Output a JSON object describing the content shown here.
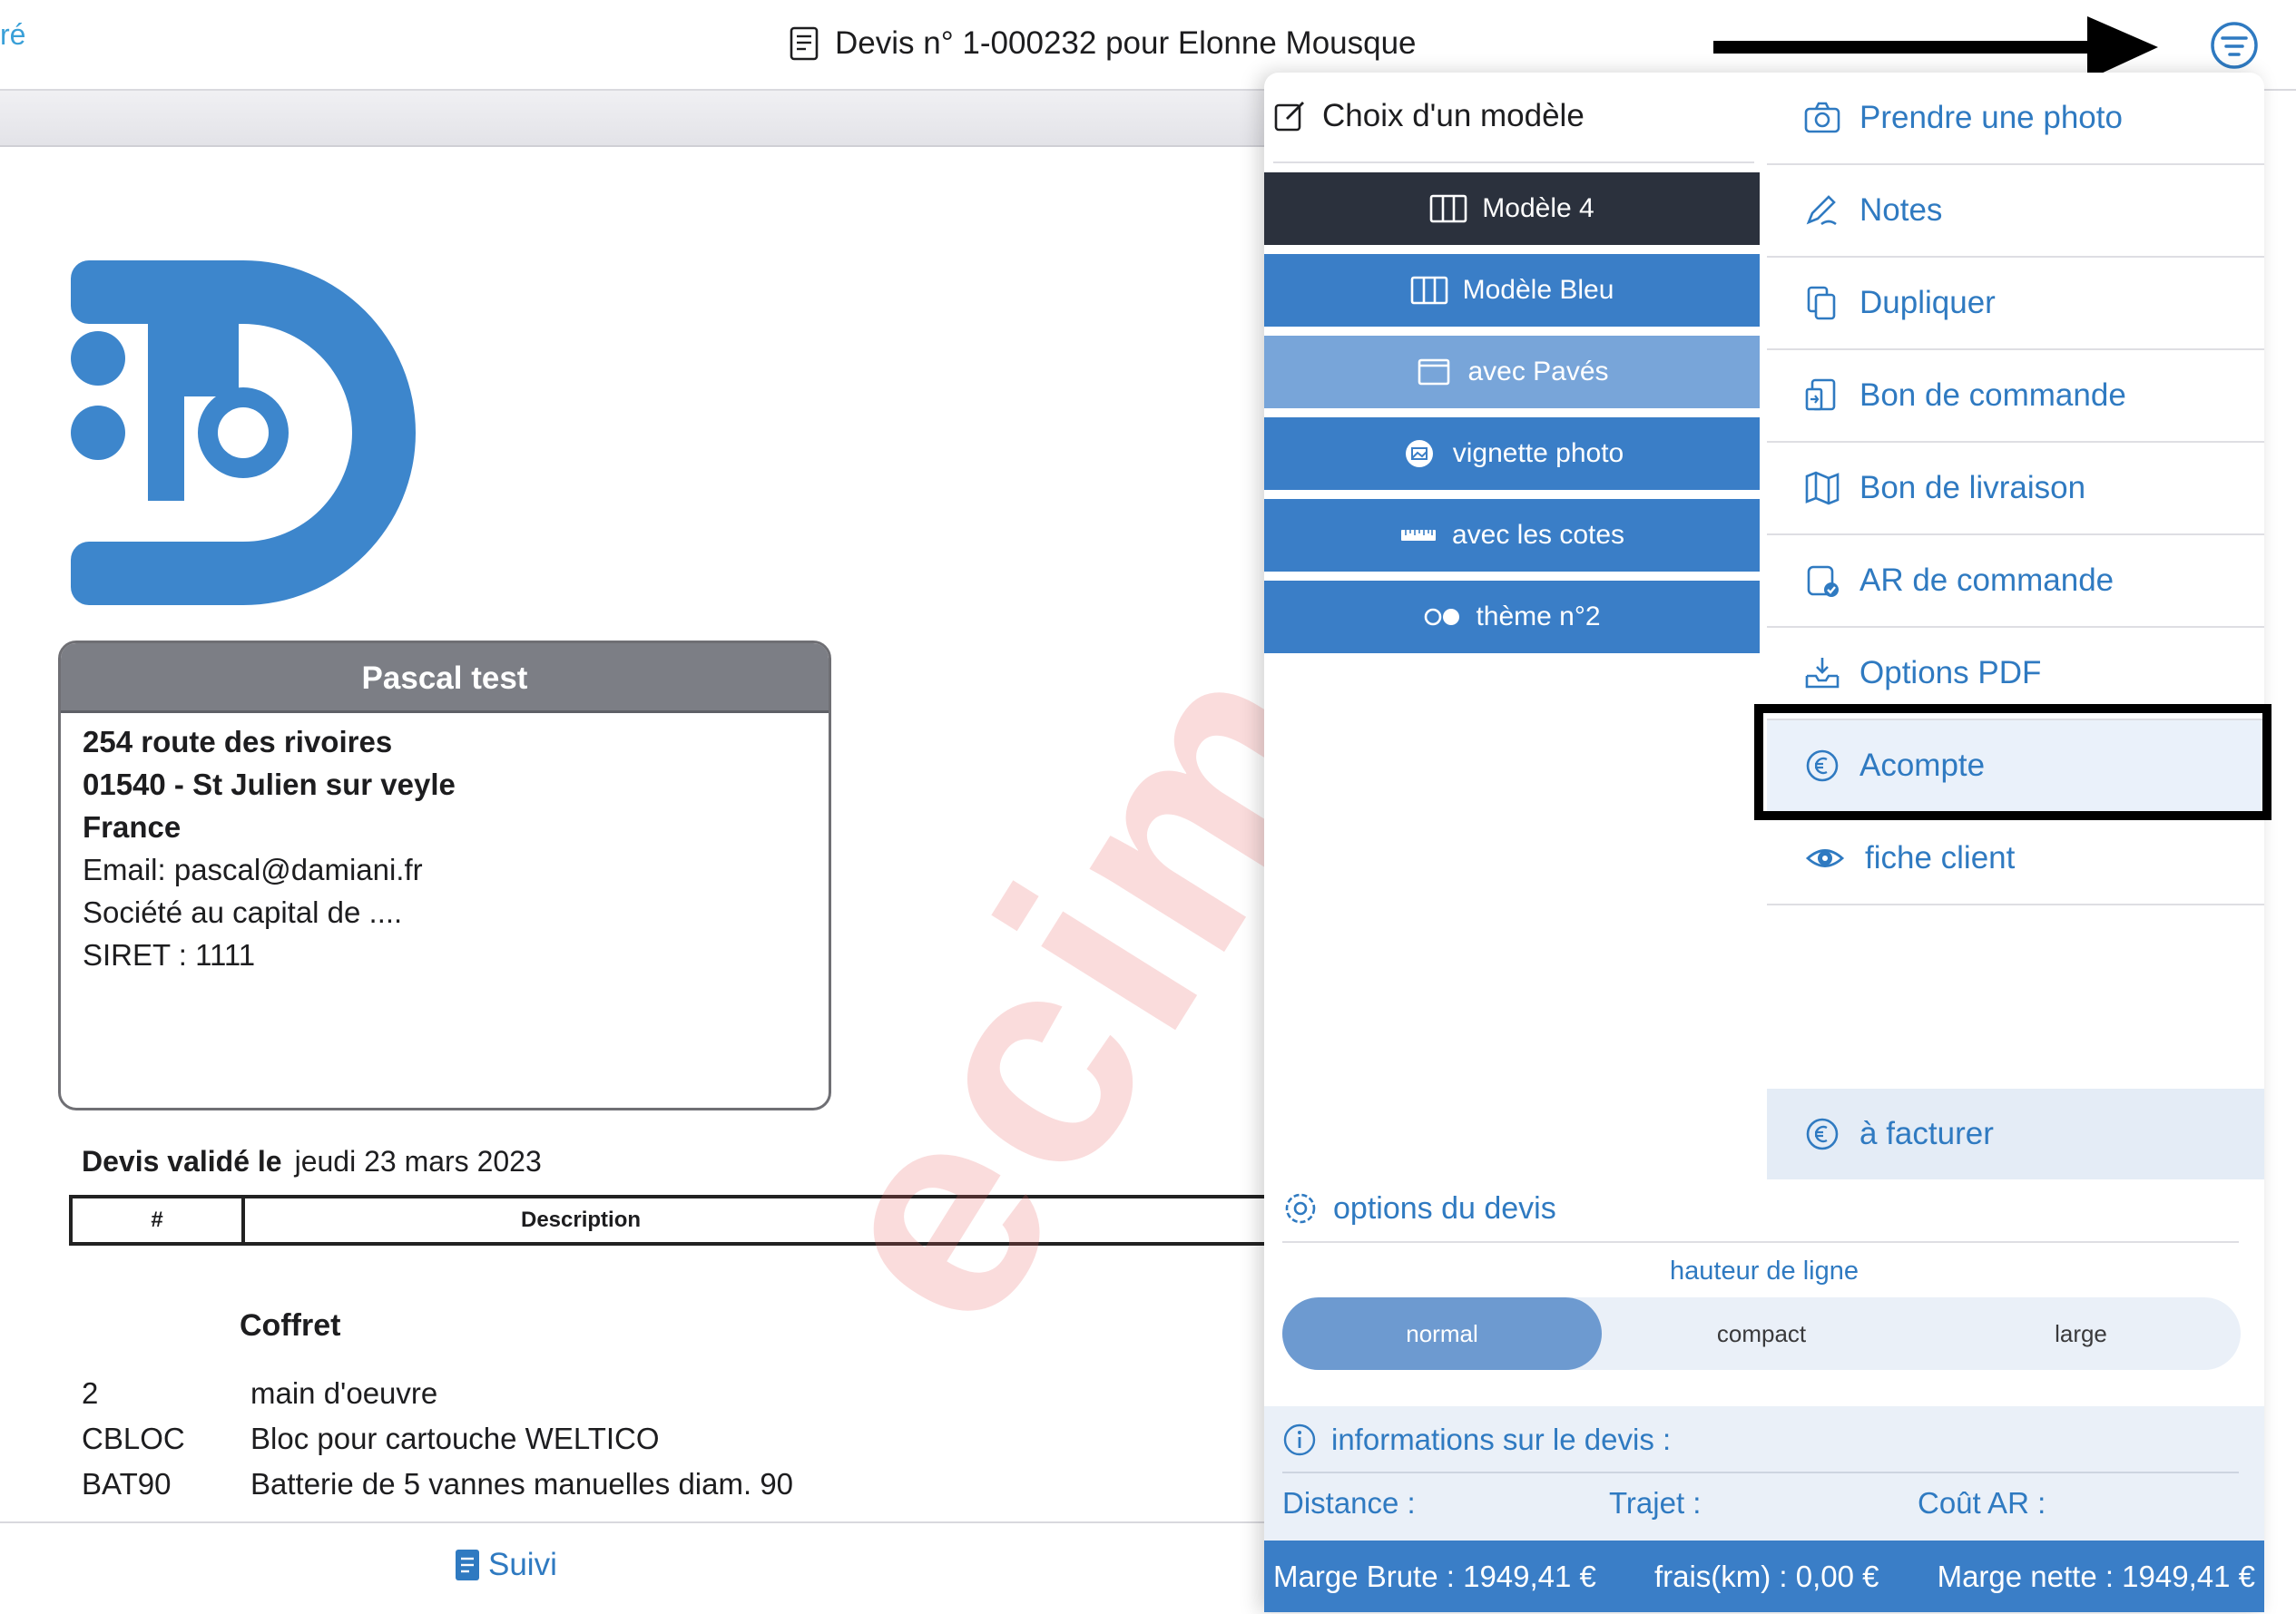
{
  "header": {
    "back_label": "ré",
    "title": "Devis n° 1-000232 pour Elonne Mousque"
  },
  "document": {
    "client": {
      "name": "Pascal test",
      "address_line1": "254 route des rivoires",
      "address_line2": "01540 - St Julien sur veyle",
      "country": "France",
      "email": "Email: pascal@damiani.fr",
      "capital": "Société au capital de ....",
      "siret": "SIRET : 1111"
    },
    "validated_label": "Devis validé le",
    "validated_date": "jeudi 23 mars 2023",
    "table_headers": [
      "#",
      "Description"
    ],
    "section_title": "Coffret",
    "rows": [
      {
        "code": "2",
        "description": "main d'oeuvre"
      },
      {
        "code": "CBLOC",
        "description": "Bloc pour cartouche WELTICO"
      },
      {
        "code": "BAT90",
        "description": "Batterie de 5 vannes manuelles diam. 90"
      }
    ],
    "watermark": "ecim"
  },
  "bottom": {
    "suivi_label": "Suivi"
  },
  "popover": {
    "models_title": "Choix d'un modèle",
    "models": [
      {
        "label": "Modèle 4",
        "icon": "columns-icon",
        "color": "#2b313d"
      },
      {
        "label": "Modèle Bleu",
        "icon": "columns-icon",
        "color": "#3a7ec7"
      },
      {
        "label": "avec Pavés",
        "icon": "window-icon",
        "color": "#78a5d9"
      },
      {
        "label": "vignette photo",
        "icon": "image-icon",
        "color": "#3a7ec7"
      },
      {
        "label": "avec les cotes",
        "icon": "ruler-icon",
        "color": "#3a7ec7"
      },
      {
        "label": "thème n°2",
        "icon": "theme-dots-icon",
        "color": "#3a7ec7"
      }
    ],
    "menu": [
      {
        "label": "Prendre une photo",
        "icon": "camera-icon"
      },
      {
        "label": "Notes",
        "icon": "pen-icon"
      },
      {
        "label": "Dupliquer",
        "icon": "duplicate-icon"
      },
      {
        "label": "Bon de commande",
        "icon": "order-icon"
      },
      {
        "label": "Bon de livraison",
        "icon": "map-icon"
      },
      {
        "label": "AR de commande",
        "icon": "ack-icon"
      },
      {
        "label": "Options PDF",
        "icon": "download-tray-icon"
      },
      {
        "label": "Acompte",
        "icon": "euro-icon"
      },
      {
        "label": "fiche client",
        "icon": "eye-icon"
      }
    ],
    "facturer_label": "à facturer",
    "options_title": "options du devis",
    "line_height_title": "hauteur de ligne",
    "line_height_options": [
      "normal",
      "compact",
      "large"
    ],
    "line_height_selected": "normal",
    "info_title": "informations sur le devis :",
    "info_fields": {
      "distance": "Distance :",
      "trajet": "Trajet :",
      "cout_ar": "Coût AR :"
    },
    "marge_brute": "Marge Brute : 1949,41 €",
    "frais_km": "frais(km) : 0,00 €",
    "marge_nette": "Marge nette : 1949,41 €"
  },
  "colors": {
    "accent": "#2f7ac1",
    "dark_button": "#2b313d",
    "blue_button": "#3a7ec7",
    "light_button": "#78a5d9",
    "logo_blue": "#3d86cc"
  }
}
